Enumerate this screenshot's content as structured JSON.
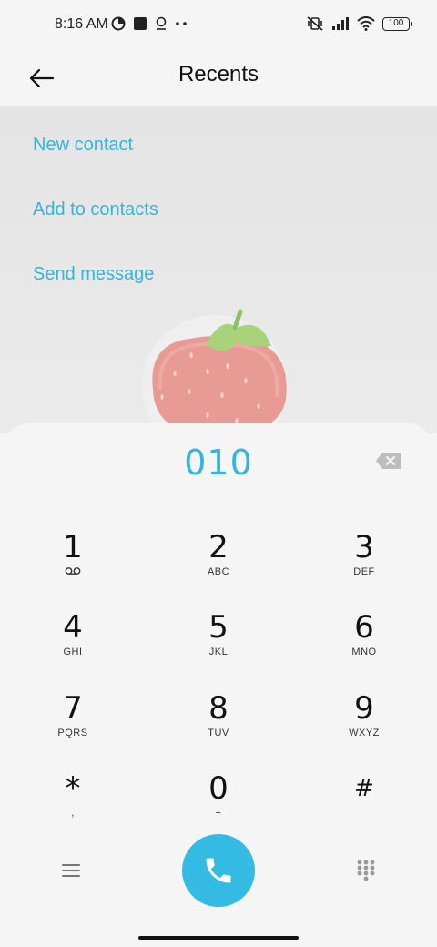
{
  "status_bar": {
    "time": "8:16 AM",
    "battery": "100",
    "left_icons": [
      "data-saver-icon",
      "square-app-icon",
      "location-icon",
      "more-dots-icon"
    ],
    "right_icons": [
      "mute-vibrate-icon",
      "signal-icon",
      "wifi-icon",
      "battery-icon"
    ]
  },
  "header": {
    "title": "Recents",
    "back_icon": "back-arrow-icon"
  },
  "actions": {
    "new_contact": "New contact",
    "add_to_contacts": "Add to contacts",
    "send_message": "Send message"
  },
  "dialpad": {
    "number": "010",
    "keys": [
      {
        "digit": "1",
        "letters": ""
      },
      {
        "digit": "2",
        "letters": "ABC"
      },
      {
        "digit": "3",
        "letters": "DEF"
      },
      {
        "digit": "4",
        "letters": "GHI"
      },
      {
        "digit": "5",
        "letters": "JKL"
      },
      {
        "digit": "6",
        "letters": "MNO"
      },
      {
        "digit": "7",
        "letters": "PQRS"
      },
      {
        "digit": "8",
        "letters": "TUV"
      },
      {
        "digit": "9",
        "letters": "WXYZ"
      },
      {
        "digit": "*",
        "letters": ","
      },
      {
        "digit": "0",
        "letters": "+"
      },
      {
        "digit": "#",
        "letters": ""
      }
    ]
  },
  "colors": {
    "accent": "#32b5e0",
    "call_button": "#33bbe3",
    "background": "#f5f5f5"
  }
}
